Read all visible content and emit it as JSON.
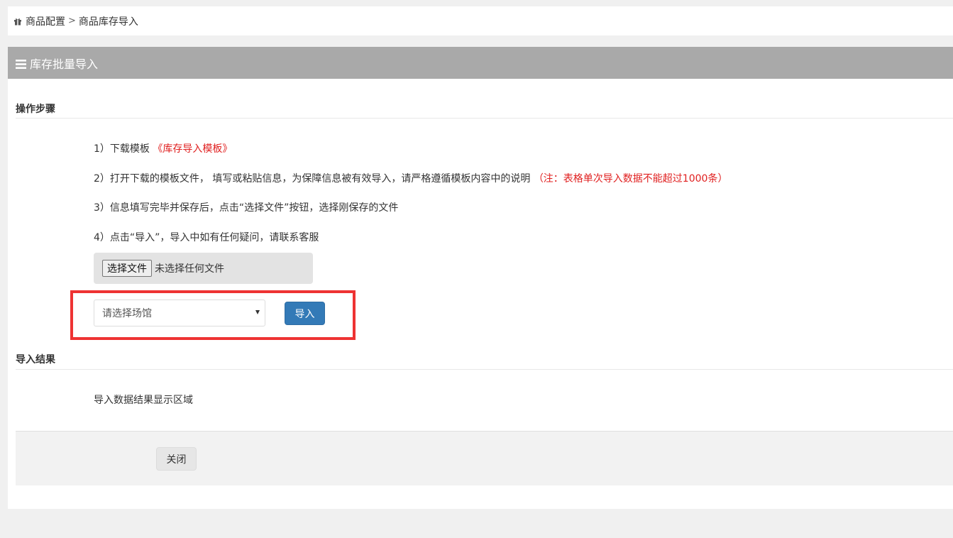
{
  "breadcrumb": {
    "icon": "gift-icon",
    "items": [
      "商品配置",
      "商品库存导入"
    ],
    "separator": ">"
  },
  "panel": {
    "title": "库存批量导入",
    "icon": "menu-bars-icon",
    "header_color": "#a9a9a9"
  },
  "steps_section": {
    "title": "操作步骤",
    "step1_text": "1）下载模板",
    "step1_link": "《库存导入模板》",
    "step2_text": "2）打开下载的模板文件， 填写或粘贴信息，为保障信息被有效导入，请严格遵循模板内容中的说明",
    "step2_note": "（注：表格单次导入数据不能超过1000条）",
    "step3_text": "3）信息填写完毕并保存后，点击“选择文件”按钮，选择刚保存的文件",
    "step4_text": "4）点击“导入”，导入中如有任何疑问，请联系客服"
  },
  "file_input": {
    "button_label": "选择文件",
    "status": "未选择任何文件"
  },
  "venue_select": {
    "selected": "请选择场馆"
  },
  "import_button": {
    "label": "导入",
    "color": "#337ab7"
  },
  "result_section": {
    "title": "导入结果",
    "placeholder": "导入数据结果显示区域"
  },
  "footer": {
    "close_label": "关闭"
  },
  "highlight_color": "#ee3333"
}
